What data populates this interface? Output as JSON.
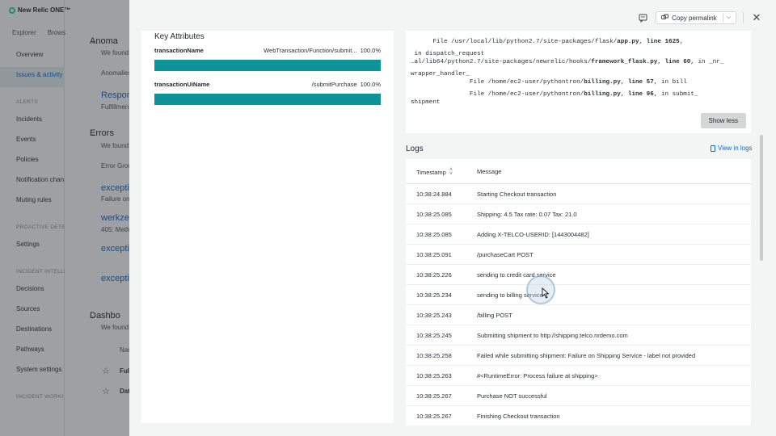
{
  "app": {
    "brand": "New Relic ONE™",
    "top_tabs": [
      "Explorer",
      "Brows"
    ],
    "nav": [
      {
        "type": "item",
        "label": "Overview"
      },
      {
        "type": "item",
        "label": "Issues & activity",
        "active": true
      },
      {
        "type": "section",
        "label": "ALERTS"
      },
      {
        "type": "item",
        "label": "Incidents"
      },
      {
        "type": "item",
        "label": "Events"
      },
      {
        "type": "item",
        "label": "Policies"
      },
      {
        "type": "item",
        "label": "Notification chan"
      },
      {
        "type": "item",
        "label": "Muting rules"
      },
      {
        "type": "section",
        "label": "PROACTIVE DETEC"
      },
      {
        "type": "item",
        "label": "Settings"
      },
      {
        "type": "section",
        "label": "INCIDENT INTELLI"
      },
      {
        "type": "item",
        "label": "Decisions"
      },
      {
        "type": "item",
        "label": "Sources"
      },
      {
        "type": "item",
        "label": "Destinations"
      },
      {
        "type": "item",
        "label": "Pathways"
      },
      {
        "type": "item",
        "label": "System settings"
      },
      {
        "type": "section",
        "label": "INCIDENT WORKI"
      }
    ],
    "main": {
      "anomalies": {
        "title": "Anoma",
        "found": "We found",
        "label": "Anomalies",
        "link": "Respon",
        "sub": "Fulfillmen"
      },
      "errors": {
        "title": "Errors",
        "found": "We found",
        "group": "Error Grou",
        "items": [
          {
            "link": "exceptio",
            "sub": "Failure on"
          },
          {
            "link": "werkzeu",
            "sub": "405: Meth"
          },
          {
            "link": "exceptio",
            "sub": ""
          },
          {
            "link": "exceptio",
            "sub": ""
          }
        ]
      },
      "dashboards": {
        "title": "Dashbo",
        "found": "We found",
        "col": "Nam",
        "rows": [
          "Full",
          "Dat"
        ]
      }
    }
  },
  "flyout": {
    "copy_permalink": "Copy permalink",
    "key_attributes": {
      "title": "Key Attributes",
      "attributes": [
        {
          "name": "transactionName",
          "value": "WebTransaction/Function/submit...",
          "percent": "100.0%",
          "fill": 1.0
        },
        {
          "name": "transactionUiName",
          "value": "/submitPurchase",
          "percent": "100.0%",
          "fill": 1.0
        }
      ]
    },
    "stack_trace": {
      "lines": [
        {
          "pre": "      File /usr/local/lib/python2.7/site-packages/flask/",
          "bold": "app.py",
          "mid": ", ",
          "bold2": "line 1625",
          "post": ","
        },
        {
          "pre": " in dispatch_request",
          "bold": "",
          "mid": "",
          "bold2": "",
          "post": ""
        },
        {
          "pre": "…al/lib64/python2.7/site-packages/newrelic/hooks/",
          "bold": "framework_flask.py",
          "mid": ", ",
          "bold2": "line 60",
          "post": ", in _nr_"
        },
        {
          "pre": "wrapper_handler_",
          "bold": "",
          "mid": "",
          "bold2": "",
          "post": ""
        },
        {
          "pre": "                File /home/ec2-user/pythontron/",
          "bold": "billing.py",
          "mid": ", ",
          "bold2": "line 57",
          "post": ", in bill"
        },
        {
          "pre": "                File /home/ec2-user/pythontron/",
          "bold": "billing.py",
          "mid": ", ",
          "bold2": "line 96",
          "post": ", in submit_"
        },
        {
          "pre": "shipment",
          "bold": "",
          "mid": "",
          "bold2": "",
          "post": ""
        }
      ],
      "show_less": "Show less"
    },
    "logs": {
      "title": "Logs",
      "view_in_logs": "View in logs",
      "columns": {
        "timestamp": "Timestamp",
        "message": "Message"
      },
      "rows": [
        {
          "ts": "10:38:24.884",
          "msg": "Starting Checkout transaction"
        },
        {
          "ts": "10:38:25.085",
          "msg": "Shipping: 4.5 Tax rate: 0.07 Tax: 21.0"
        },
        {
          "ts": "10:38:25.085",
          "msg": "Adding X-TELCO-USERID: [1443004482]"
        },
        {
          "ts": "10:38:25.091",
          "msg": "/purchaseCart POST"
        },
        {
          "ts": "10:38:25.226",
          "msg": "sending to credit card service"
        },
        {
          "ts": "10:38:25.234",
          "msg": "sending to billing service"
        },
        {
          "ts": "10:38:25.243",
          "msg": "/billing POST"
        },
        {
          "ts": "10:38:25.245",
          "msg": "Submitting shipment to http://shipping.telco.nrdemo.com"
        },
        {
          "ts": "10:38:25.258",
          "msg": "Failed while submitting shipment: Failure on Shipping Service - label not provided"
        },
        {
          "ts": "10:38:25.263",
          "msg": "#<RuntimeError: Process failure at shipping>"
        },
        {
          "ts": "10:38:25.267",
          "msg": "Purchase NOT successful"
        },
        {
          "ts": "10:38:25.267",
          "msg": "Finishing Checkout transaction"
        }
      ]
    }
  },
  "colors": {
    "bar": "#0c9499",
    "link": "#0b6acb",
    "brand_dot": "#1ce783"
  }
}
